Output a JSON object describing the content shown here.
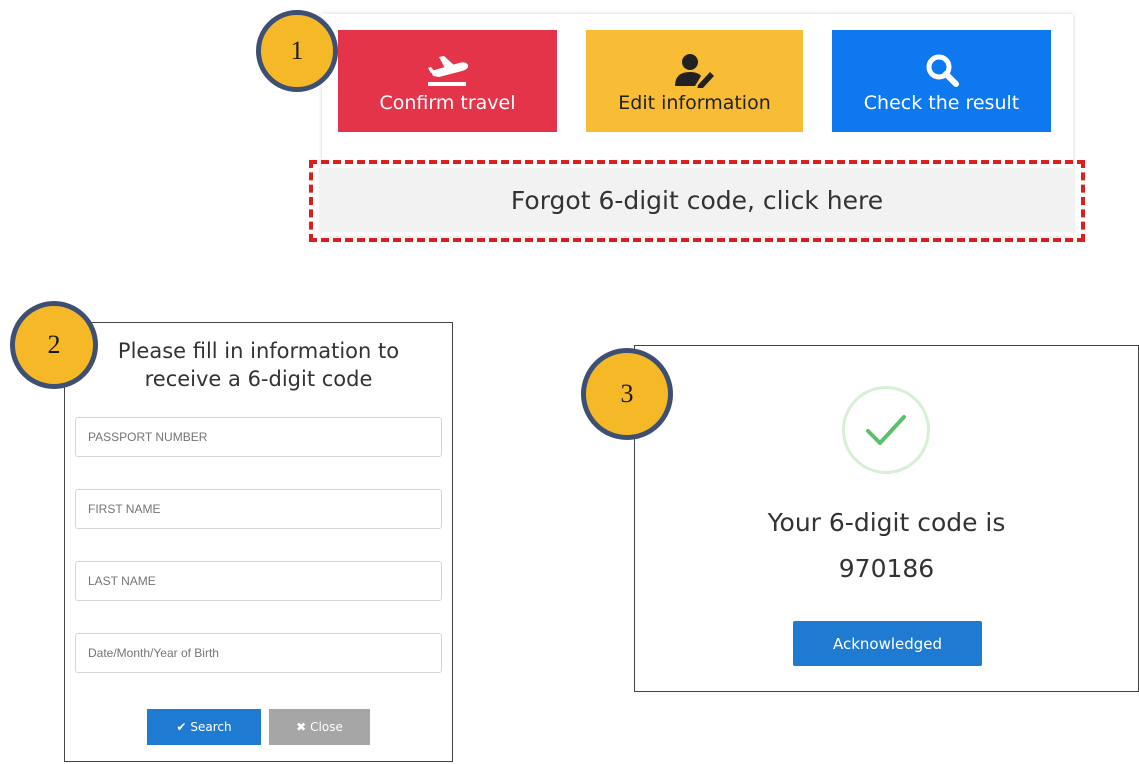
{
  "steps": {
    "one": "1",
    "two": "2",
    "three": "3"
  },
  "actions": {
    "confirm_travel": "Confirm travel",
    "edit_information": "Edit information",
    "check_result": "Check the result",
    "forgot_code": "Forgot 6-digit code, click here"
  },
  "form": {
    "title": "Please fill in information to receive a 6-digit code",
    "passport_placeholder": "PASSPORT NUMBER",
    "first_name_placeholder": "FIRST NAME",
    "last_name_placeholder": "LAST NAME",
    "dob_placeholder": "Date/Month/Year of Birth",
    "search_label": "Search",
    "close_label": "Close"
  },
  "result": {
    "label": "Your 6-digit code is",
    "code": "970186",
    "ack_label": "Acknowledged"
  },
  "colors": {
    "confirm": "#e3344a",
    "edit": "#f9bd35",
    "check": "#0e78ee",
    "primary_button": "#1f7bd2",
    "close_button": "#a6a6a6",
    "dashed_border": "#dc1e1e",
    "badge": "#f5b928",
    "badge_border": "#3d4f73",
    "success": "#5cc06b"
  },
  "icons": {
    "confirm": "plane-departure-icon",
    "edit": "user-edit-icon",
    "check": "search-icon",
    "success": "check-icon",
    "search_button": "check-icon",
    "close_button": "times-icon"
  }
}
